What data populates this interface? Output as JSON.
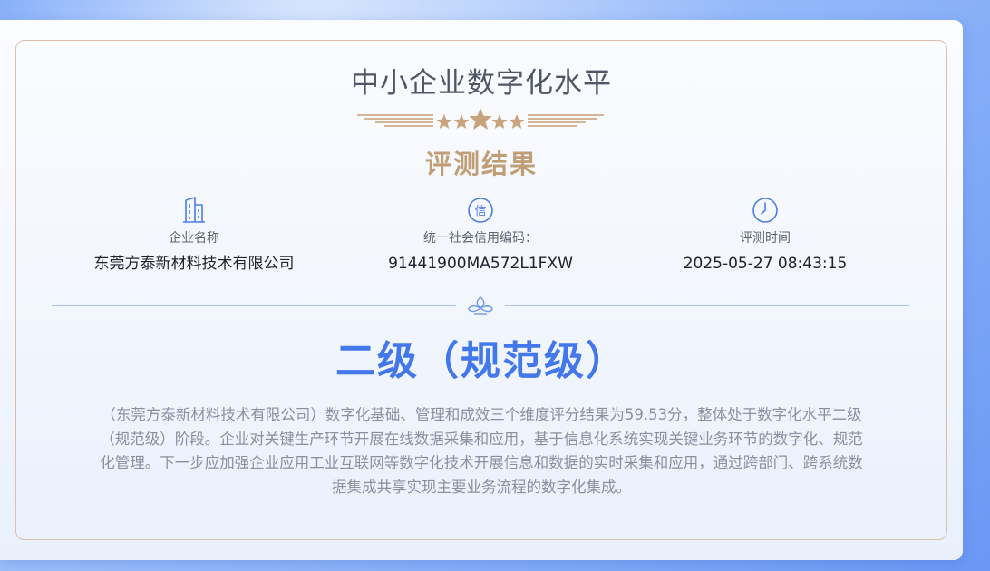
{
  "title": "中小企业数字化水平",
  "subtitle": "评测结果",
  "info": {
    "company": {
      "icon": "building-icon",
      "label": "企业名称",
      "value": "东莞方泰新材料技术有限公司"
    },
    "credit_code": {
      "icon": "credit-icon",
      "label": "统一社会信用编码：",
      "value": "91441900MA572L1FXW"
    },
    "eval_time": {
      "icon": "clock-icon",
      "label": "评测时间",
      "value": "2025-05-27 08:43:15"
    }
  },
  "level": "二级（规范级）",
  "description": "（东莞方泰新材料技术有限公司）数字化基础、管理和成效三个维度评分结果为59.53分，整体处于数字化水平二级（规范级）阶段。企业对关键生产环节开展在线数据采集和应用，基于信息化系统实现关键业务环节的数字化、规范化管理。下一步应加强企业应用工业互联网等数字化技术开展信息和数据的实时采集和应用，通过跨部门、跨系统数据集成共享实现主要业务流程的数字化集成。",
  "colors": {
    "accent_blue": "#4377ec",
    "gold": "#c19e76",
    "frame_border": "#d9c0a6",
    "text_dark": "#1f2329",
    "text_muted": "#8b919c"
  }
}
